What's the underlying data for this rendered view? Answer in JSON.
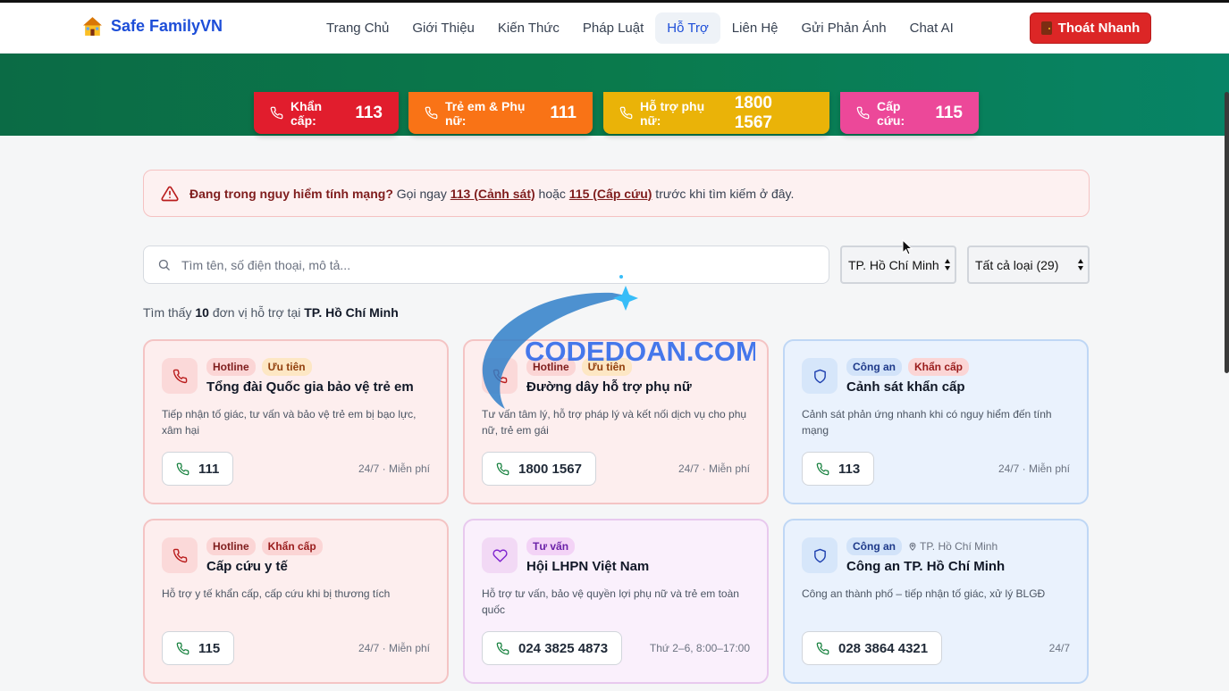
{
  "nav": {
    "brand": "Safe FamilyVN",
    "menu": [
      "Trang Chủ",
      "Giới Thiệu",
      "Kiến Thức",
      "Pháp Luật",
      "Hỗ Trợ",
      "Liên Hệ",
      "Gửi Phản Ánh",
      "Chat AI"
    ],
    "active_index": 4,
    "quit_label": "Thoát Nhanh"
  },
  "hotlines": [
    {
      "label": "Khẩn cấp:",
      "number": "113",
      "color": "#e11d2d"
    },
    {
      "label": "Trẻ em & Phụ nữ:",
      "number": "111",
      "color": "#f97316"
    },
    {
      "label": "Hỗ trợ phụ nữ:",
      "number": "1800 1567",
      "color": "#eab308"
    },
    {
      "label": "Cấp cứu:",
      "number": "115",
      "color": "#ec4899"
    }
  ],
  "alert": {
    "strong": "Đang trong nguy hiểm tính mạng?",
    "text1": " Gọi ngay ",
    "link1": "113 (Cảnh sát)",
    "text2": " hoặc ",
    "link2": "115 (Cấp cứu)",
    "text3": " trước khi tìm kiếm ở đây."
  },
  "search": {
    "placeholder": "Tìm tên, số điện thoại, mô tả...",
    "value": "",
    "city": "TP. Hồ Chí Minh",
    "type": "Tất cả loại (29)"
  },
  "result": {
    "prefix": "Tìm thấy ",
    "count": "10",
    "middle": " đơn vị hỗ trợ tại ",
    "city": "TP. Hồ Chí Minh"
  },
  "cards": [
    {
      "tags": [
        "Hotline",
        "Ưu tiên"
      ],
      "title": "Tổng đài Quốc gia bảo vệ trẻ em",
      "desc": "Tiếp nhận tố giác, tư vấn và bảo vệ trẻ em bị bạo lực, xâm hại",
      "phone": "111",
      "meta": "24/7 · Miễn phí"
    },
    {
      "tags": [
        "Hotline",
        "Ưu tiên"
      ],
      "title": "Đường dây hỗ trợ phụ nữ",
      "desc": "Tư vấn tâm lý, hỗ trợ pháp lý và kết nối dịch vụ cho phụ nữ, trẻ em gái",
      "phone": "1800 1567",
      "meta": "24/7 · Miễn phí"
    },
    {
      "tags": [
        "Công an",
        "Khẩn cấp"
      ],
      "title": "Cảnh sát khẩn cấp",
      "desc": "Cảnh sát phản ứng nhanh khi có nguy hiểm đến tính mạng",
      "phone": "113",
      "meta": "24/7 · Miễn phí"
    },
    {
      "tags": [
        "Hotline",
        "Khẩn cấp"
      ],
      "title": "Cấp cứu y tế",
      "desc": "Hỗ trợ y tế khẩn cấp, cấp cứu khi bị thương tích",
      "phone": "115",
      "meta": "24/7 · Miễn phí"
    },
    {
      "tags": [
        "Tư vấn"
      ],
      "title": "Hội LHPN Việt Nam",
      "desc": "Hỗ trợ tư vấn, bảo vệ quyền lợi phụ nữ và trẻ em toàn quốc",
      "phone": "024 3825 4873",
      "meta": "Thứ 2–6, 8:00–17:00"
    },
    {
      "tags": [
        "Công an"
      ],
      "location": "TP. Hồ Chí Minh",
      "title": "Công an TP. Hồ Chí Minh",
      "desc": "Công an thành phố – tiếp nhận tố giác, xử lý BLGĐ",
      "phone": "028 3864 4321",
      "meta": "24/7"
    }
  ],
  "watermark": "CODEDOAN.COM",
  "icons": {
    "brand": "house-icon",
    "quit": "door-icon",
    "alert": "warning-triangle-icon",
    "search": "search-icon",
    "hotline": "phone-icon",
    "police": "shield-icon",
    "advice": "heart-icon",
    "location": "pin-icon"
  },
  "colors": {
    "brand": "#1d4ed8",
    "danger": "#dc2626",
    "hero": "#0a7a4c"
  }
}
